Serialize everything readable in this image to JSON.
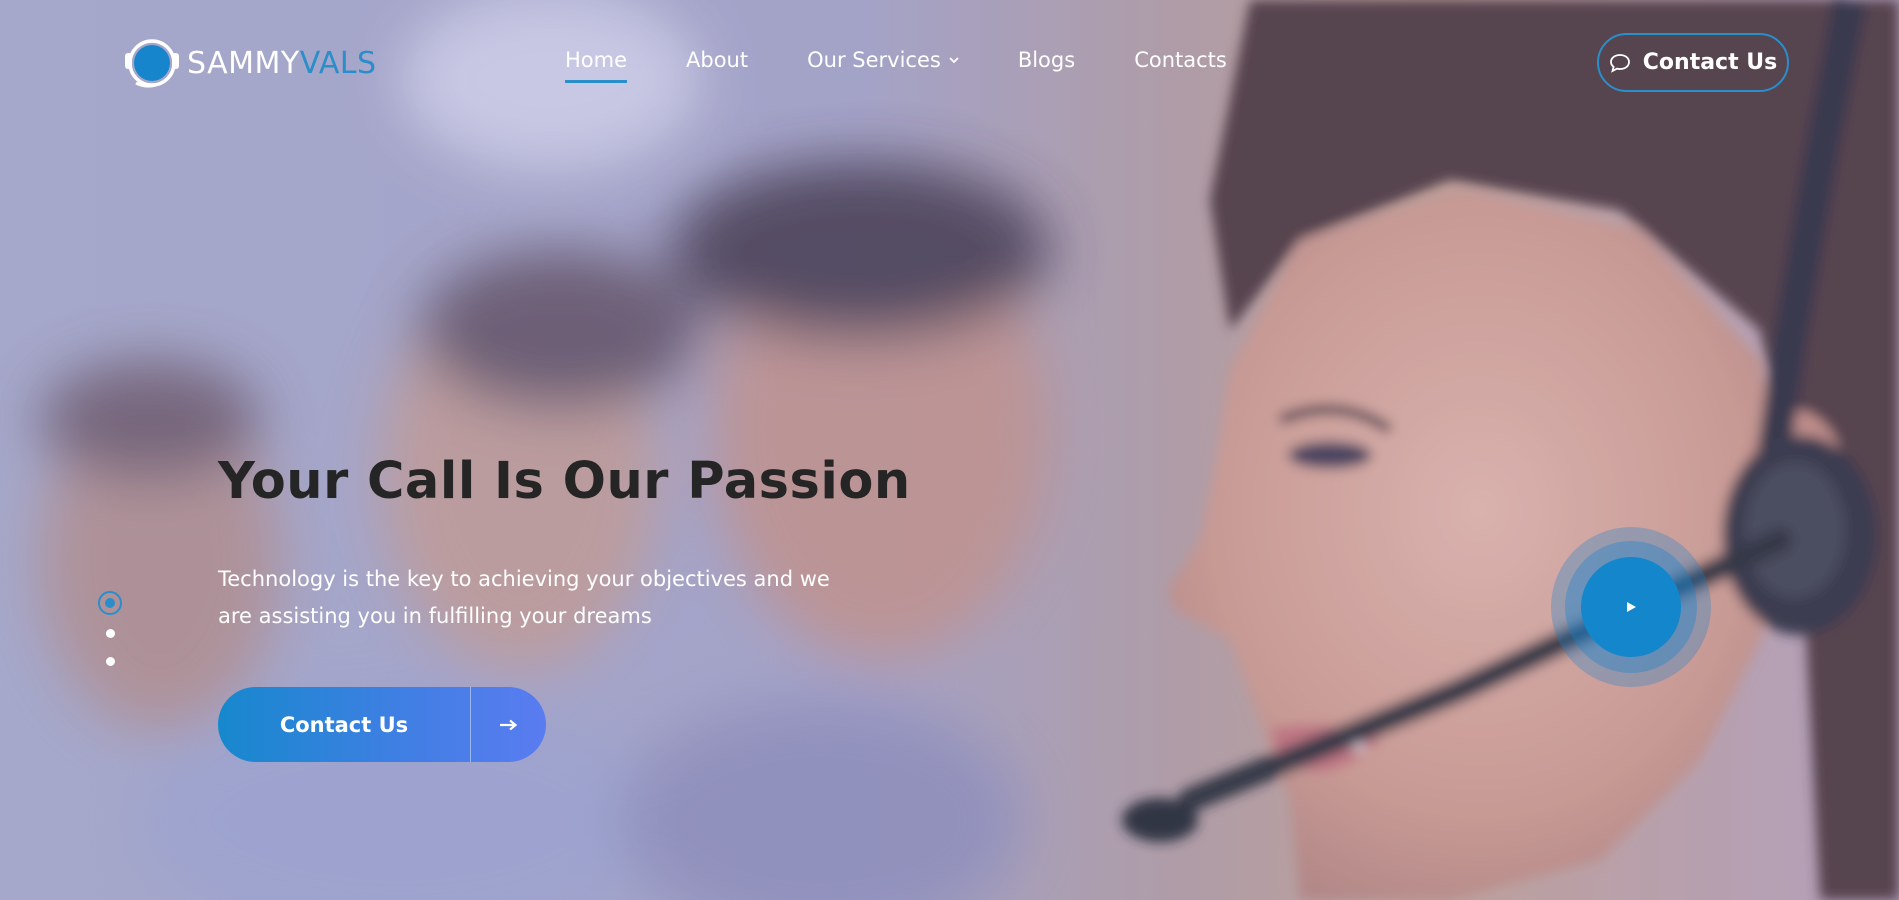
{
  "brand": {
    "name_part1": "SAMMY",
    "name_part2": "VALS",
    "accent_color": "#2a8ecb"
  },
  "nav": {
    "items": [
      {
        "label": "Home",
        "active": true
      },
      {
        "label": "About"
      },
      {
        "label": "Our Services",
        "has_dropdown": true
      },
      {
        "label": "Blogs"
      },
      {
        "label": "Contacts"
      }
    ]
  },
  "header_cta": {
    "label": "Contact Us",
    "icon": "chat-bubble-icon"
  },
  "hero": {
    "headline": "Your Call Is Our Passion",
    "subtext": "Technology is the key to achieving your objectives and we are assisting you in fulfilling your dreams",
    "cta_label": "Contact Us",
    "cta_icon": "arrow-right-icon",
    "background": "call-center-agent-with-headset-photo"
  },
  "slider": {
    "total": 3,
    "active_index": 0
  },
  "play_button": {
    "icon": "play-icon"
  }
}
